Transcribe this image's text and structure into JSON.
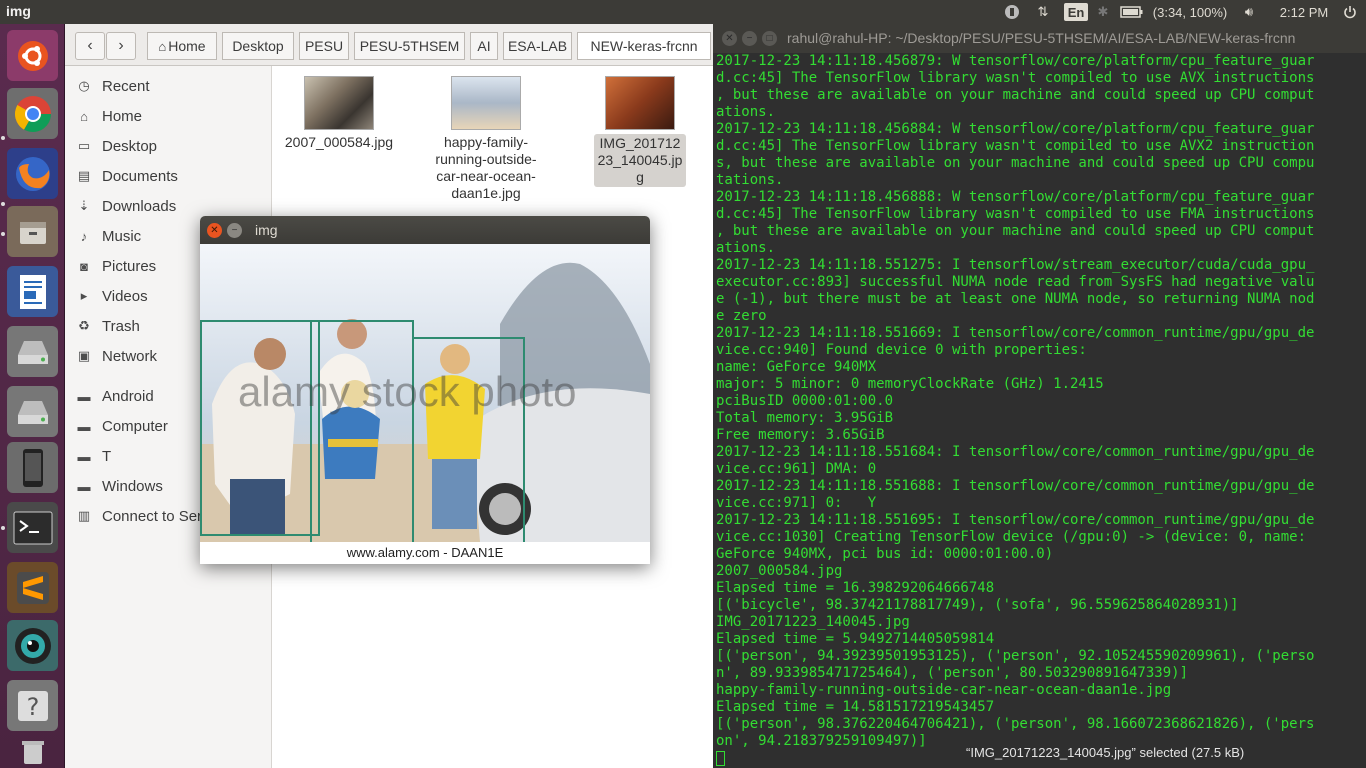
{
  "top_panel": {
    "app_title": "img",
    "keyboard_layout": "En",
    "battery_text": "(3:34, 100%)",
    "clock": "2:12 PM",
    "icons": [
      "updates-icon",
      "network-icon",
      "keyboard-icon",
      "bluetooth-icon",
      "battery-icon",
      "volume-icon",
      "power-icon"
    ]
  },
  "launcher": {
    "items": [
      {
        "name": "ubuntu-dash",
        "icon": "ubuntu-logo-icon"
      },
      {
        "name": "chrome",
        "icon": "chrome-icon"
      },
      {
        "name": "firefox",
        "icon": "firefox-icon"
      },
      {
        "name": "files",
        "icon": "file-manager-icon"
      },
      {
        "name": "writer",
        "icon": "libreoffice-writer-icon"
      },
      {
        "name": "drive-1",
        "icon": "hard-drive-icon"
      },
      {
        "name": "drive-2",
        "icon": "hard-drive-icon"
      },
      {
        "name": "phone",
        "icon": "phone-icon"
      },
      {
        "name": "terminal",
        "icon": "terminal-icon"
      },
      {
        "name": "sublime",
        "icon": "sublime-text-icon"
      },
      {
        "name": "camera",
        "icon": "camera-lens-icon"
      },
      {
        "name": "help",
        "icon": "help-icon"
      },
      {
        "name": "trash",
        "icon": "trash-icon"
      }
    ]
  },
  "nautilus": {
    "breadcrumbs": [
      "Home",
      "Desktop",
      "PESU",
      "PESU-5THSEM",
      "AI",
      "ESA-LAB",
      "NEW-keras-frcnn"
    ],
    "sidebar": [
      {
        "label": "Recent",
        "icon": "clock-icon"
      },
      {
        "label": "Home",
        "icon": "home-icon"
      },
      {
        "label": "Desktop",
        "icon": "folder-icon"
      },
      {
        "label": "Documents",
        "icon": "document-icon"
      },
      {
        "label": "Downloads",
        "icon": "download-icon"
      },
      {
        "label": "Music",
        "icon": "music-icon"
      },
      {
        "label": "Pictures",
        "icon": "camera-icon"
      },
      {
        "label": "Videos",
        "icon": "video-icon"
      },
      {
        "label": "Trash",
        "icon": "trash-icon"
      },
      {
        "label": "Network",
        "icon": "network-icon"
      },
      {
        "label": "Android",
        "icon": "drive-icon"
      },
      {
        "label": "Computer",
        "icon": "drive-icon"
      },
      {
        "label": "T",
        "icon": "drive-icon"
      },
      {
        "label": "Windows",
        "icon": "drive-icon"
      },
      {
        "label": "Connect to Server",
        "icon": "server-icon"
      }
    ],
    "files": [
      {
        "name": "2007_000584.jpg",
        "thumb": "#7d7060"
      },
      {
        "name": "happy-family-running-outside-car-near-ocean-daan1e.jpg",
        "thumb": "#aab7c7"
      },
      {
        "name": "IMG_20171223_140045.jpg",
        "thumb": "#8a3a1c"
      }
    ],
    "status": "“IMG_20171223_140045.jpg” selected  (27.5 kB)"
  },
  "image_window": {
    "title": "img",
    "watermark": "alamy stock photo",
    "caption": "www.alamy.com - DAAN1E",
    "box_color": "#2e8b70"
  },
  "terminal": {
    "title": "rahul@rahul-HP: ~/Desktop/PESU/PESU-5THSEM/AI/ESA-LAB/NEW-keras-frcnn",
    "lines": [
      "2017-12-23 14:11:18.456879: W tensorflow/core/platform/cpu_feature_guar",
      "d.cc:45] The TensorFlow library wasn't compiled to use AVX instructions",
      ", but these are available on your machine and could speed up CPU comput",
      "ations.",
      "2017-12-23 14:11:18.456884: W tensorflow/core/platform/cpu_feature_guar",
      "d.cc:45] The TensorFlow library wasn't compiled to use AVX2 instruction",
      "s, but these are available on your machine and could speed up CPU compu",
      "tations.",
      "2017-12-23 14:11:18.456888: W tensorflow/core/platform/cpu_feature_guar",
      "d.cc:45] The TensorFlow library wasn't compiled to use FMA instructions",
      ", but these are available on your machine and could speed up CPU comput",
      "ations.",
      "2017-12-23 14:11:18.551275: I tensorflow/stream_executor/cuda/cuda_gpu_",
      "executor.cc:893] successful NUMA node read from SysFS had negative valu",
      "e (-1), but there must be at least one NUMA node, so returning NUMA nod",
      "e zero",
      "2017-12-23 14:11:18.551669: I tensorflow/core/common_runtime/gpu/gpu_de",
      "vice.cc:940] Found device 0 with properties:",
      "name: GeForce 940MX",
      "major: 5 minor: 0 memoryClockRate (GHz) 1.2415",
      "pciBusID 0000:01:00.0",
      "Total memory: 3.95GiB",
      "Free memory: 3.65GiB",
      "2017-12-23 14:11:18.551684: I tensorflow/core/common_runtime/gpu/gpu_de",
      "vice.cc:961] DMA: 0",
      "2017-12-23 14:11:18.551688: I tensorflow/core/common_runtime/gpu/gpu_de",
      "vice.cc:971] 0:   Y",
      "2017-12-23 14:11:18.551695: I tensorflow/core/common_runtime/gpu/gpu_de",
      "vice.cc:1030] Creating TensorFlow device (/gpu:0) -> (device: 0, name:",
      "GeForce 940MX, pci bus id: 0000:01:00.0)",
      "2007_000584.jpg",
      "Elapsed time = 16.398292064666748",
      "[('bicycle', 98.37421178817749), ('sofa', 96.559625864028931)]",
      "IMG_20171223_140045.jpg",
      "Elapsed time = 5.9492714405059814",
      "[('person', 94.39239501953125), ('person', 92.105245590209961), ('perso",
      "n', 89.933985471725464), ('person', 80.503290891647339)]",
      "happy-family-running-outside-car-near-ocean-daan1e.jpg",
      "Elapsed time = 14.581517219543457",
      "[('person', 98.376220464706421), ('person', 98.166072368621826), ('pers",
      "on', 94.218379259109497)]"
    ]
  }
}
